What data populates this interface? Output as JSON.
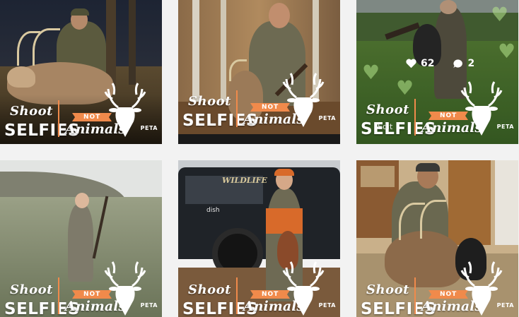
{
  "grid": {
    "tiles": [
      {
        "id": "post-1"
      },
      {
        "id": "post-2"
      },
      {
        "id": "post-3",
        "likes": "62",
        "comments": "2",
        "edit_label": "Edit"
      },
      {
        "id": "post-4"
      },
      {
        "id": "post-5",
        "truck_text": "WILDLIFE",
        "truck_sub": "dish"
      },
      {
        "id": "post-6"
      }
    ]
  },
  "campaign": {
    "shoot": "Shoot",
    "selfies": "SELFIES",
    "not": "NOT",
    "animals": "Animals",
    "brand": "PETA"
  },
  "colors": {
    "accent": "#f08a4b",
    "background": "#f2f2f2",
    "overlay_text": "#ffffff"
  },
  "icons": {
    "like": "heart-icon",
    "comment": "comment-bubble-icon",
    "logo": "deer-head-icon"
  }
}
